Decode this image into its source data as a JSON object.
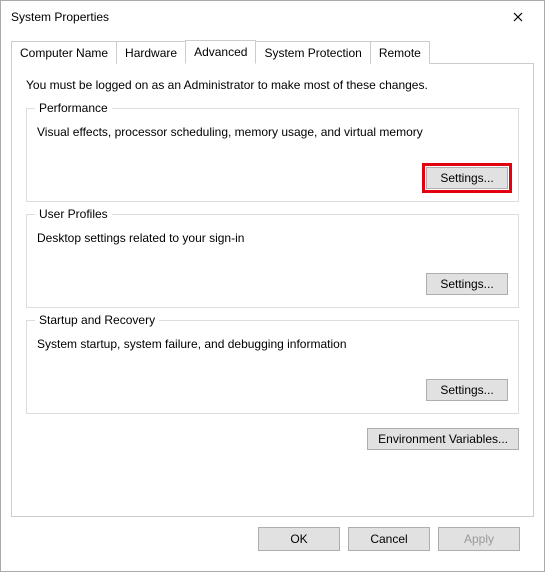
{
  "window": {
    "title": "System Properties"
  },
  "tabs": {
    "computer_name": "Computer Name",
    "hardware": "Hardware",
    "advanced": "Advanced",
    "system_protection": "System Protection",
    "remote": "Remote"
  },
  "intro": "You must be logged on as an Administrator to make most of these changes.",
  "performance": {
    "legend": "Performance",
    "desc": "Visual effects, processor scheduling, memory usage, and virtual memory",
    "button": "Settings..."
  },
  "user_profiles": {
    "legend": "User Profiles",
    "desc": "Desktop settings related to your sign-in",
    "button": "Settings..."
  },
  "startup": {
    "legend": "Startup and Recovery",
    "desc": "System startup, system failure, and debugging information",
    "button": "Settings..."
  },
  "env_button": "Environment Variables...",
  "footer": {
    "ok": "OK",
    "cancel": "Cancel",
    "apply": "Apply"
  }
}
